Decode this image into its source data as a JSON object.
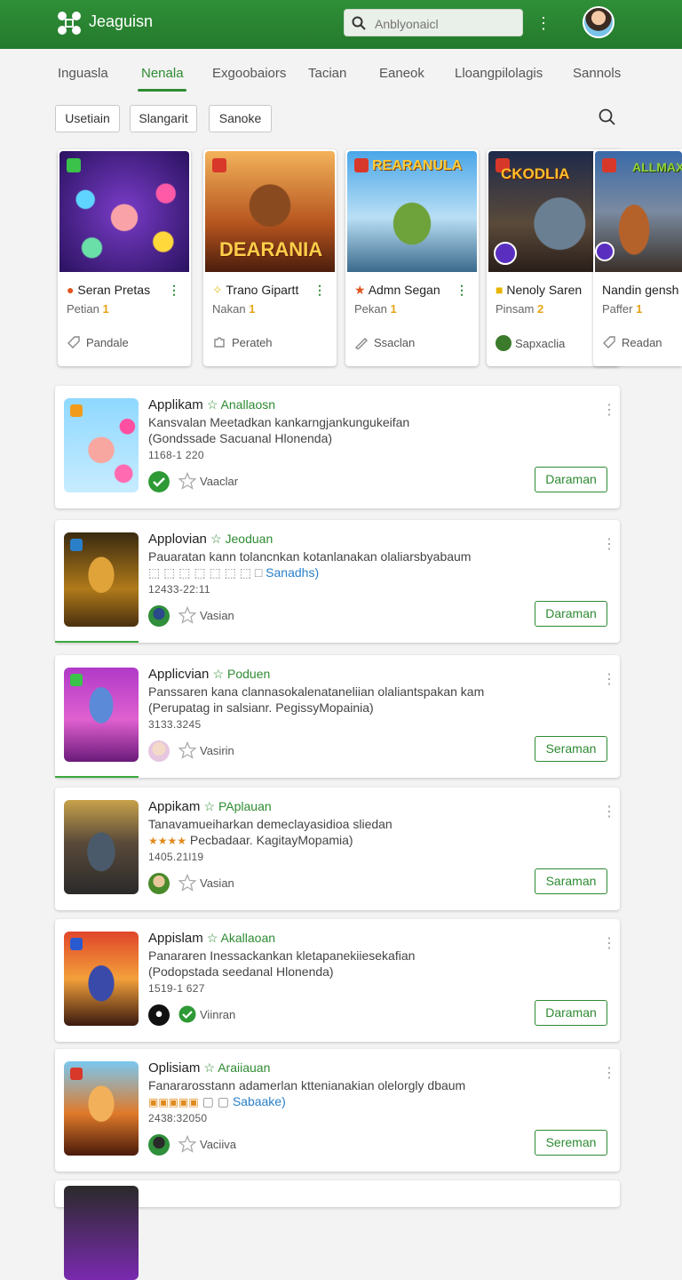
{
  "header": {
    "title": "Jeaguisn",
    "search_placeholder": "Anblyonaicl"
  },
  "tabs": [
    "Inguasla",
    "Nenala",
    "Exgoobaiors",
    "Tacian",
    "Eaneok",
    "Lloangpilolagis",
    "Sannols"
  ],
  "filters": [
    "Usetiain",
    "Slangarit",
    "Sanoke"
  ],
  "featured": [
    {
      "name": "Seran Pretas",
      "sub": "Petian",
      "num": "1",
      "foot": "Pandale"
    },
    {
      "name": "Trano Gipartt",
      "sub": "Nakan",
      "num": "1",
      "foot": "Perateh"
    },
    {
      "name": "Admn Segan",
      "sub": "Pekan",
      "num": "1",
      "foot": "Ssaclan"
    },
    {
      "name": "Nenoly Saren",
      "sub": "Pinsam",
      "num": "2",
      "foot": "Sapxaclia"
    },
    {
      "name": "Nandin gensh",
      "sub": "Paffer",
      "num": "1",
      "foot": "Readan"
    }
  ],
  "featured_art": [
    "DEARANIA",
    "REARANULA",
    "CKODLIA",
    "ALLMAX"
  ],
  "list": [
    {
      "title": "Applikam",
      "tag": "Anallaosn",
      "desc": "Kansvalan Meetadkan kankarngjankungukeifan",
      "desc2": "(Gondssade Sacuanal Hlonenda)",
      "desc2_extra": "",
      "meta": "1168-1 220",
      "actor": "Vaaclar",
      "button": "Daraman"
    },
    {
      "title": "Applovian",
      "tag": "Jeoduan",
      "desc": "Pauaratan kann tolancnkan kotanlanakan olaliarsbyabaum",
      "desc2": "",
      "desc2_extra": "Sanadhs)",
      "meta": "12433-22:11",
      "actor": "Vasian",
      "button": "Daraman"
    },
    {
      "title": "Applicvian",
      "tag": "Poduen",
      "desc": "Panssaren kana clannasokalenataneliian olaliantspakan kam",
      "desc2": "(Perupatag in salsianr. PegissyMopainia)",
      "desc2_extra": "",
      "meta": "3133.3245",
      "actor": "Vasirin",
      "button": "Seraman"
    },
    {
      "title": "Appikam",
      "tag": "PAplauan",
      "desc": "Tanavamueiharkan demeclayasidioa sliedan",
      "desc2": "Pecbadaar. KagitayMopamia)",
      "desc2_extra": "",
      "meta": "1405.21l19",
      "actor": "Vasian",
      "button": "Saraman"
    },
    {
      "title": "Appislam",
      "tag": "Akallaoan",
      "desc": "Panararen Inessackankan kletapanekiiesekafian",
      "desc2": "(Podopstada seedanal Hlonenda)",
      "desc2_extra": "",
      "meta": "1519-1 627",
      "actor": "Viinran",
      "button": "Daraman"
    },
    {
      "title": "Oplisiam",
      "tag": "Araiiauan",
      "desc": "Fanararosstann adamerlan kttenianakian olelorgly dbaum",
      "desc2": "",
      "desc2_extra": "Sabaake)",
      "meta": "2438:32050",
      "actor": "Vaciiva",
      "button": "Sereman"
    }
  ]
}
